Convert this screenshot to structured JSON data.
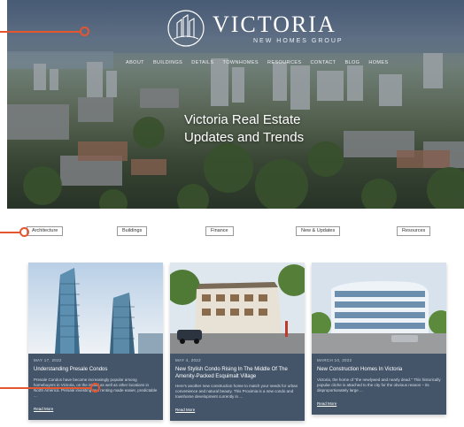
{
  "logo": {
    "name": "VICTORIA",
    "subtitle": "NEW HOMES GROUP"
  },
  "nav": [
    "ABOUT",
    "BUILDINGS",
    "DETAILS",
    "TOWNHOMES",
    "RESOURCES",
    "CONTACT",
    "BLOG",
    "HOMES"
  ],
  "hero": {
    "title_line1": "Victoria Real Estate",
    "title_line2": "Updates and Trends"
  },
  "tabs": [
    "Architecture",
    "Buildings",
    "Finance",
    "New & Updates",
    "Resources"
  ],
  "cards": [
    {
      "date": "MAY 17, 2022",
      "title": "Understanding Presale Condos",
      "text": "Presale Condos have become increasingly popular among homebuyers in Victoria, on the island as well as other locations in North America. Presale investing and renting made easier, predictable ...",
      "link": "Read More"
    },
    {
      "date": "MAY 4, 2022",
      "title": "New Stylish Condo Rising In The Middle Of The Amenity-Packed Esquimalt Village",
      "text": "Here's another new construction home to match your needs for urban convenience and natural beauty. This Proximia is a new condo and townhome development currently in ...",
      "link": "Read More"
    },
    {
      "date": "MARCH 10, 2022",
      "title": "New Construction Homes In Victoria",
      "text": "Victoria, the home of \"the newlywed and nearly dead.\" This historically popular cliche is attached to the city for the obvious reason – its disproportionately large ...",
      "link": "Read More"
    }
  ],
  "colors": {
    "accent": "#e4562f",
    "card_bg": "#44556a"
  }
}
